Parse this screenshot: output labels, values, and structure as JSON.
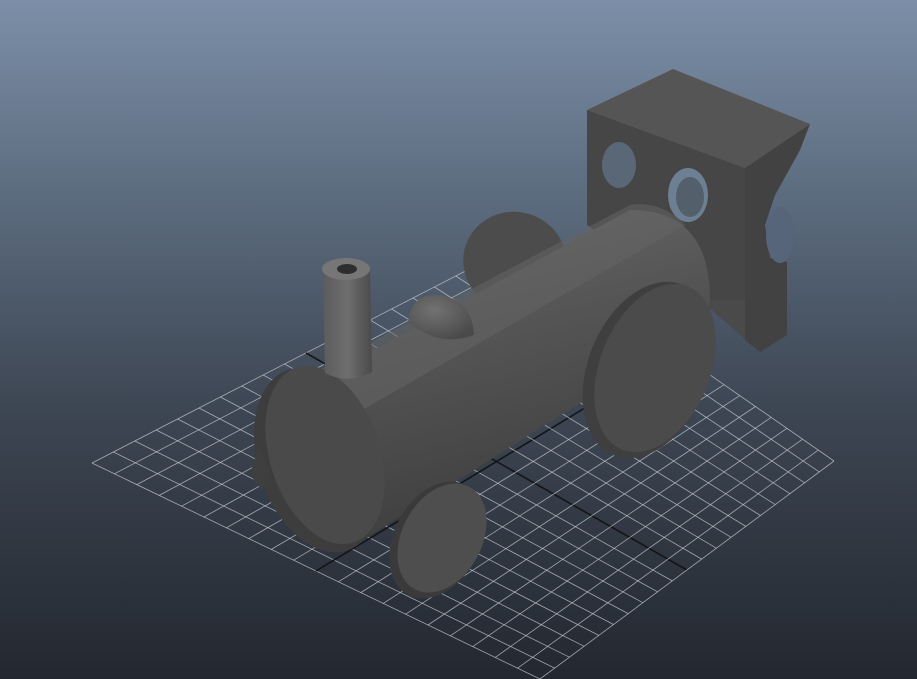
{
  "viewport": {
    "colors": {
      "background_top": "#7c8fa8",
      "background_bottom": "#232830",
      "grid_line": "#c9cdd3",
      "grid_axis": "#111111",
      "model_base": "#4b4b4b",
      "model_highlight": "#6a6a6a",
      "model_shadow": "#3a3a3a"
    },
    "grid": {
      "visible": true,
      "divisions": 20
    },
    "object": {
      "name": "train-engine",
      "parts": [
        "boiler",
        "smokestack",
        "dome",
        "cab",
        "front-wheel",
        "rear-wheel-left",
        "rear-wheel-right",
        "cab-windows"
      ]
    }
  }
}
